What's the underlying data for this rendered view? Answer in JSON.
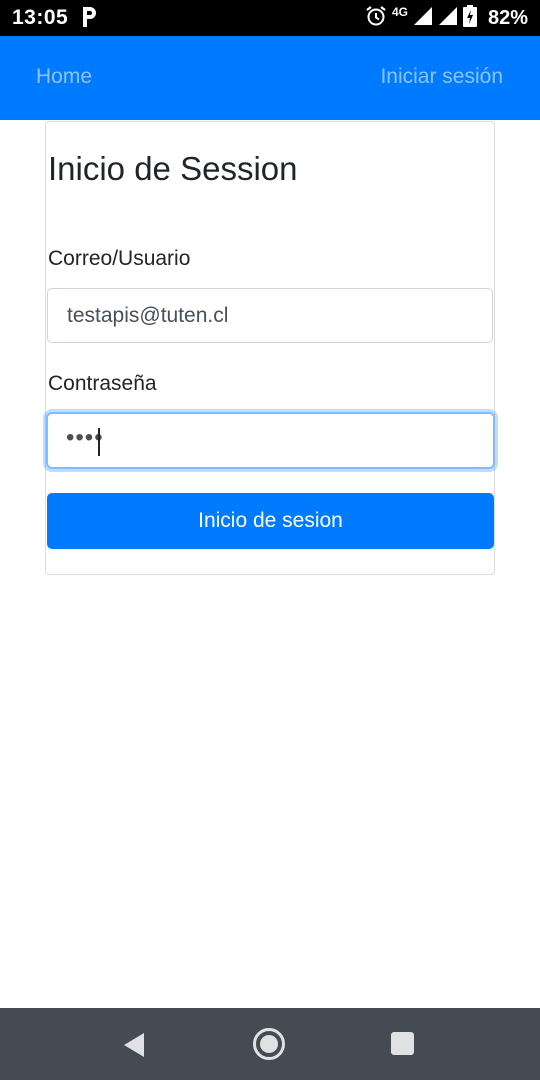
{
  "status_bar": {
    "time": "13:05",
    "network": "4G",
    "battery": "82%",
    "icons": [
      "parking-icon",
      "alarm-icon",
      "signal-icon",
      "signal-icon",
      "battery-charging-icon"
    ]
  },
  "navbar": {
    "home_label": "Home",
    "login_label": "Iniciar sesión",
    "color": "#007bff"
  },
  "form": {
    "title": "Inicio de Session",
    "user_label": "Correo/Usuario",
    "user_value": "testapis@tuten.cl",
    "password_label": "Contraseña",
    "password_value": "••••",
    "submit_label": "Inicio de sesion"
  },
  "system_nav": {
    "icons": [
      "back-icon",
      "home-icon",
      "recents-icon"
    ]
  }
}
